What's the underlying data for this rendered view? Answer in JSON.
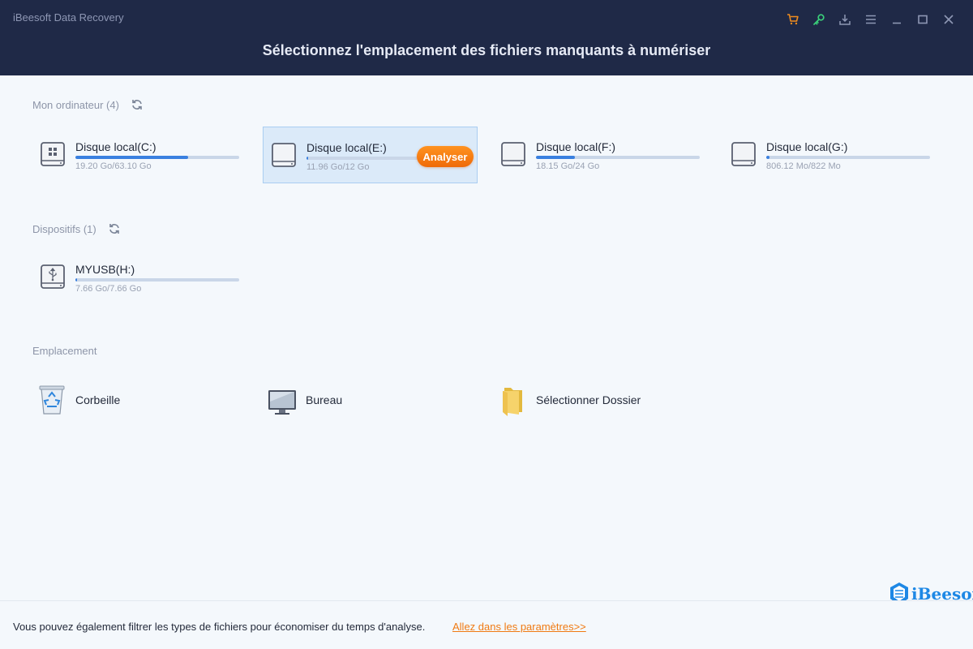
{
  "window": {
    "app_title": "iBeesoft Data Recovery",
    "page_title": "Sélectionnez l'emplacement des fichiers manquants à numériser"
  },
  "window_controls": [
    {
      "icon": "cart-icon",
      "color": "#f08c1e"
    },
    {
      "icon": "key-icon",
      "color": "#3ad07a"
    },
    {
      "icon": "download-icon",
      "color": "#8e97b4"
    },
    {
      "icon": "menu-icon",
      "color": "#8e97b4"
    },
    {
      "icon": "minimize-icon",
      "color": "#8e97b4"
    },
    {
      "icon": "maximize-icon",
      "color": "#8e97b4"
    },
    {
      "icon": "close-icon",
      "color": "#8e97b4"
    }
  ],
  "computer": {
    "title": "Mon ordinateur (4)",
    "drives": [
      {
        "name": "Disque local(C:)",
        "size": "19.20 Go/63.10 Go",
        "used_fraction": 0.69,
        "selected": false
      },
      {
        "name": "Disque local(E:)",
        "size": "11.96 Go/12 Go",
        "used_fraction": 0.01,
        "selected": true
      },
      {
        "name": "Disque local(F:)",
        "size": "18.15 Go/24 Go",
        "used_fraction": 0.24,
        "selected": false
      },
      {
        "name": "Disque local(G:)",
        "size": "806.12 Mo/822 Mo",
        "used_fraction": 0.02,
        "selected": false
      }
    ],
    "analyse_label": "Analyser"
  },
  "devices": {
    "title": "Dispositifs (1)",
    "drives": [
      {
        "name": "MYUSB(H:)",
        "size": "7.66 Go/7.66 Go",
        "used_fraction": 0.01
      }
    ]
  },
  "locations": {
    "title": "Emplacement",
    "items": [
      {
        "label": "Corbeille",
        "icon": "recycle-bin-icon"
      },
      {
        "label": "Bureau",
        "icon": "desktop-monitor-icon"
      },
      {
        "label": "Sélectionner Dossier",
        "icon": "folder-icon"
      }
    ]
  },
  "footer": {
    "text": "Vous pouvez également filtrer les types de fichiers pour économiser du temps d'analyse.",
    "link": "Allez dans les paramètres>>"
  },
  "logo": {
    "text": "iBeesoft"
  },
  "colors": {
    "header_bg": "#1f2947",
    "accent_orange": "#f07a12",
    "progress_blue": "#3a80e0",
    "selected_bg": "#dbeaf9"
  }
}
